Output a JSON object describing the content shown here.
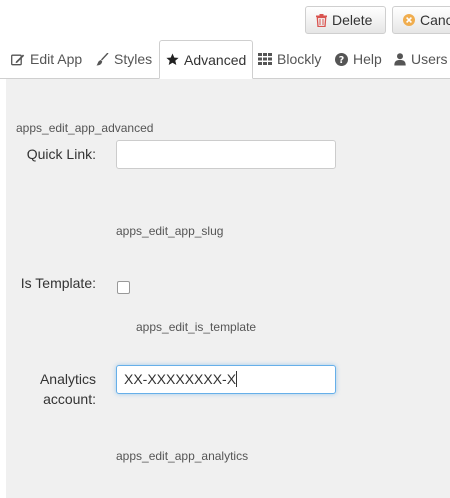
{
  "toolbar": {
    "delete_label": "Delete",
    "cancel_label": "Canc"
  },
  "tabs": [
    {
      "label": "Edit App",
      "icon": "edit-icon"
    },
    {
      "label": "Styles",
      "icon": "brush-icon"
    },
    {
      "label": "Advanced",
      "icon": "star-icon",
      "active": true
    },
    {
      "label": "Blockly",
      "icon": "grid-icon"
    },
    {
      "label": "Help",
      "icon": "question-icon"
    },
    {
      "label": "Users",
      "icon": "user-icon"
    }
  ],
  "form": {
    "section_title": "apps_edit_app_advanced",
    "quick_link": {
      "label": "Quick Link:",
      "value": "",
      "help": "apps_edit_app_slug"
    },
    "is_template": {
      "label": "Is Template:",
      "checked": false,
      "help": "apps_edit_is_template"
    },
    "analytics": {
      "label_line1": "Analytics",
      "label_line2": "account:",
      "value": "XX-XXXXXXXX-X",
      "help": "apps_edit_app_analytics"
    }
  },
  "colors": {
    "delete_icon": "#d9534f",
    "cancel_icon": "#f0ad4e",
    "focus_border": "#66afe9",
    "panel_bg": "#f0f0f0"
  }
}
